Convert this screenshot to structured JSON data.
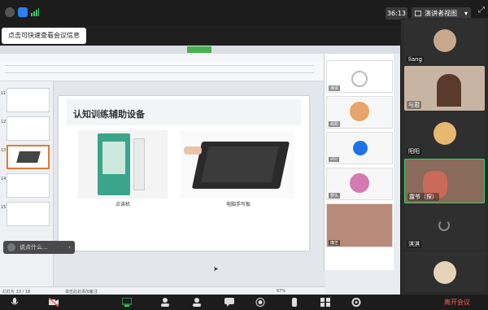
{
  "topbar": {
    "timer": "36:13",
    "view_label": "演讲者视图",
    "tooltip": "点击可快速查看会议信息"
  },
  "shared": {
    "slide_title": "认知训练辅助设备",
    "caption_left": "点读机",
    "caption_right": "电脑手写板",
    "comment_placeholder": "说点什么...",
    "thumbs": [
      "11",
      "12",
      "13",
      "14",
      "15"
    ],
    "statusbar_left": "幻灯片 13 / 18",
    "statusbar_mid": "单击此处添加备注",
    "zoom": "67%"
  },
  "share_panel": {
    "names": [
      "演讲",
      "甜甜",
      "stcl",
      "梦头",
      "廉芝"
    ]
  },
  "rightcol": {
    "tiles": [
      {
        "name": "liang"
      },
      {
        "name": "与君"
      },
      {
        "name": "阳阳"
      },
      {
        "name": "露爷（探）"
      },
      {
        "name": "淇淇"
      },
      {
        "name": ""
      }
    ]
  },
  "toolbar": {
    "leave": "离开会议"
  },
  "colors": {
    "accent_orange": "#e07a3a",
    "leave_red": "#ff5a5a",
    "bg_dark": "#1f1f1f"
  }
}
